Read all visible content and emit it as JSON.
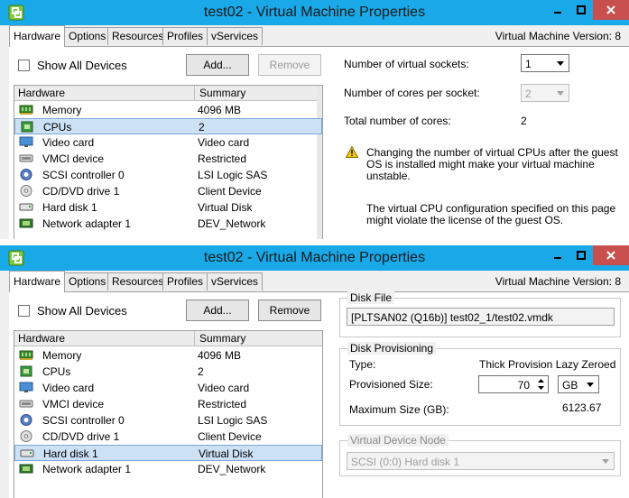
{
  "window1": {
    "title": "test02 - Virtual Machine Properties",
    "vm_version": "Virtual Machine Version: 8",
    "tabs": [
      {
        "label": "Hardware",
        "active": true
      },
      {
        "label": "Options"
      },
      {
        "label": "Resources"
      },
      {
        "label": "Profiles"
      },
      {
        "label": "vServices"
      }
    ],
    "show_all_devices": "Show All Devices",
    "add_button": "Add...",
    "remove_button": "Remove",
    "list_headers": {
      "hardware": "Hardware",
      "summary": "Summary"
    },
    "devices": [
      {
        "name": "Memory",
        "summary": "4096 MB"
      },
      {
        "name": "CPUs",
        "summary": "2"
      },
      {
        "name": "Video card",
        "summary": "Video card"
      },
      {
        "name": "VMCI device",
        "summary": "Restricted"
      },
      {
        "name": "SCSI controller 0",
        "summary": "LSI Logic SAS"
      },
      {
        "name": "CD/DVD drive 1",
        "summary": "Client Device"
      },
      {
        "name": "Hard disk 1",
        "summary": "Virtual Disk"
      },
      {
        "name": "Network adapter 1",
        "summary": "DEV_Network"
      }
    ],
    "cpu": {
      "sockets_label": "Number of virtual sockets:",
      "sockets_value": "1",
      "cores_label": "Number of cores per socket:",
      "cores_value": "2",
      "total_label": "Total number of cores:",
      "total_value": "2",
      "warning1_line1": "Changing the number of virtual CPUs after the guest",
      "warning1_line2": "OS is installed might make your virtual machine",
      "warning1_line3": "unstable.",
      "warning2_line1": "The virtual CPU configuration specified on this page",
      "warning2_line2": "might violate the license of the guest OS."
    }
  },
  "window2": {
    "title": "test02 - Virtual Machine Properties",
    "vm_version": "Virtual Machine Version: 8",
    "tabs": [
      {
        "label": "Hardware",
        "active": true
      },
      {
        "label": "Options"
      },
      {
        "label": "Resources"
      },
      {
        "label": "Profiles"
      },
      {
        "label": "vServices"
      }
    ],
    "show_all_devices": "Show All Devices",
    "add_button": "Add...",
    "remove_button": "Remove",
    "list_headers": {
      "hardware": "Hardware",
      "summary": "Summary"
    },
    "devices": [
      {
        "name": "Memory",
        "summary": "4096 MB"
      },
      {
        "name": "CPUs",
        "summary": "2"
      },
      {
        "name": "Video card",
        "summary": "Video card"
      },
      {
        "name": "VMCI device",
        "summary": "Restricted"
      },
      {
        "name": "SCSI controller 0",
        "summary": "LSI Logic SAS"
      },
      {
        "name": "CD/DVD drive 1",
        "summary": "Client Device"
      },
      {
        "name": "Hard disk 1",
        "summary": "Virtual Disk"
      },
      {
        "name": "Network adapter 1",
        "summary": "DEV_Network"
      }
    ],
    "disk": {
      "file_group": "Disk File",
      "file_path": "[PLTSAN02 (Q16b)] test02_1/test02.vmdk",
      "prov_group": "Disk Provisioning",
      "type_label": "Type:",
      "type_value": "Thick Provision Lazy Zeroed",
      "size_label": "Provisioned Size:",
      "size_value": "70",
      "size_unit": "GB",
      "max_label": "Maximum Size (GB):",
      "max_value": "6123.67",
      "vdn_group": "Virtual Device Node",
      "vdn_value": "SCSI (0:0) Hard disk 1"
    }
  }
}
